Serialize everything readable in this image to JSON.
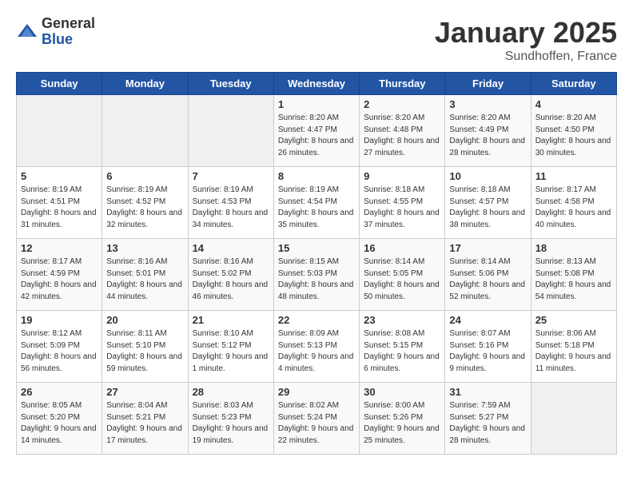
{
  "header": {
    "logo_general": "General",
    "logo_blue": "Blue",
    "title": "January 2025",
    "subtitle": "Sundhoffen, France"
  },
  "weekdays": [
    "Sunday",
    "Monday",
    "Tuesday",
    "Wednesday",
    "Thursday",
    "Friday",
    "Saturday"
  ],
  "weeks": [
    [
      {
        "day": "",
        "info": ""
      },
      {
        "day": "",
        "info": ""
      },
      {
        "day": "",
        "info": ""
      },
      {
        "day": "1",
        "info": "Sunrise: 8:20 AM\nSunset: 4:47 PM\nDaylight: 8 hours and 26 minutes."
      },
      {
        "day": "2",
        "info": "Sunrise: 8:20 AM\nSunset: 4:48 PM\nDaylight: 8 hours and 27 minutes."
      },
      {
        "day": "3",
        "info": "Sunrise: 8:20 AM\nSunset: 4:49 PM\nDaylight: 8 hours and 28 minutes."
      },
      {
        "day": "4",
        "info": "Sunrise: 8:20 AM\nSunset: 4:50 PM\nDaylight: 8 hours and 30 minutes."
      }
    ],
    [
      {
        "day": "5",
        "info": "Sunrise: 8:19 AM\nSunset: 4:51 PM\nDaylight: 8 hours and 31 minutes."
      },
      {
        "day": "6",
        "info": "Sunrise: 8:19 AM\nSunset: 4:52 PM\nDaylight: 8 hours and 32 minutes."
      },
      {
        "day": "7",
        "info": "Sunrise: 8:19 AM\nSunset: 4:53 PM\nDaylight: 8 hours and 34 minutes."
      },
      {
        "day": "8",
        "info": "Sunrise: 8:19 AM\nSunset: 4:54 PM\nDaylight: 8 hours and 35 minutes."
      },
      {
        "day": "9",
        "info": "Sunrise: 8:18 AM\nSunset: 4:55 PM\nDaylight: 8 hours and 37 minutes."
      },
      {
        "day": "10",
        "info": "Sunrise: 8:18 AM\nSunset: 4:57 PM\nDaylight: 8 hours and 38 minutes."
      },
      {
        "day": "11",
        "info": "Sunrise: 8:17 AM\nSunset: 4:58 PM\nDaylight: 8 hours and 40 minutes."
      }
    ],
    [
      {
        "day": "12",
        "info": "Sunrise: 8:17 AM\nSunset: 4:59 PM\nDaylight: 8 hours and 42 minutes."
      },
      {
        "day": "13",
        "info": "Sunrise: 8:16 AM\nSunset: 5:01 PM\nDaylight: 8 hours and 44 minutes."
      },
      {
        "day": "14",
        "info": "Sunrise: 8:16 AM\nSunset: 5:02 PM\nDaylight: 8 hours and 46 minutes."
      },
      {
        "day": "15",
        "info": "Sunrise: 8:15 AM\nSunset: 5:03 PM\nDaylight: 8 hours and 48 minutes."
      },
      {
        "day": "16",
        "info": "Sunrise: 8:14 AM\nSunset: 5:05 PM\nDaylight: 8 hours and 50 minutes."
      },
      {
        "day": "17",
        "info": "Sunrise: 8:14 AM\nSunset: 5:06 PM\nDaylight: 8 hours and 52 minutes."
      },
      {
        "day": "18",
        "info": "Sunrise: 8:13 AM\nSunset: 5:08 PM\nDaylight: 8 hours and 54 minutes."
      }
    ],
    [
      {
        "day": "19",
        "info": "Sunrise: 8:12 AM\nSunset: 5:09 PM\nDaylight: 8 hours and 56 minutes."
      },
      {
        "day": "20",
        "info": "Sunrise: 8:11 AM\nSunset: 5:10 PM\nDaylight: 8 hours and 59 minutes."
      },
      {
        "day": "21",
        "info": "Sunrise: 8:10 AM\nSunset: 5:12 PM\nDaylight: 9 hours and 1 minute."
      },
      {
        "day": "22",
        "info": "Sunrise: 8:09 AM\nSunset: 5:13 PM\nDaylight: 9 hours and 4 minutes."
      },
      {
        "day": "23",
        "info": "Sunrise: 8:08 AM\nSunset: 5:15 PM\nDaylight: 9 hours and 6 minutes."
      },
      {
        "day": "24",
        "info": "Sunrise: 8:07 AM\nSunset: 5:16 PM\nDaylight: 9 hours and 9 minutes."
      },
      {
        "day": "25",
        "info": "Sunrise: 8:06 AM\nSunset: 5:18 PM\nDaylight: 9 hours and 11 minutes."
      }
    ],
    [
      {
        "day": "26",
        "info": "Sunrise: 8:05 AM\nSunset: 5:20 PM\nDaylight: 9 hours and 14 minutes."
      },
      {
        "day": "27",
        "info": "Sunrise: 8:04 AM\nSunset: 5:21 PM\nDaylight: 9 hours and 17 minutes."
      },
      {
        "day": "28",
        "info": "Sunrise: 8:03 AM\nSunset: 5:23 PM\nDaylight: 9 hours and 19 minutes."
      },
      {
        "day": "29",
        "info": "Sunrise: 8:02 AM\nSunset: 5:24 PM\nDaylight: 9 hours and 22 minutes."
      },
      {
        "day": "30",
        "info": "Sunrise: 8:00 AM\nSunset: 5:26 PM\nDaylight: 9 hours and 25 minutes."
      },
      {
        "day": "31",
        "info": "Sunrise: 7:59 AM\nSunset: 5:27 PM\nDaylight: 9 hours and 28 minutes."
      },
      {
        "day": "",
        "info": ""
      }
    ]
  ]
}
